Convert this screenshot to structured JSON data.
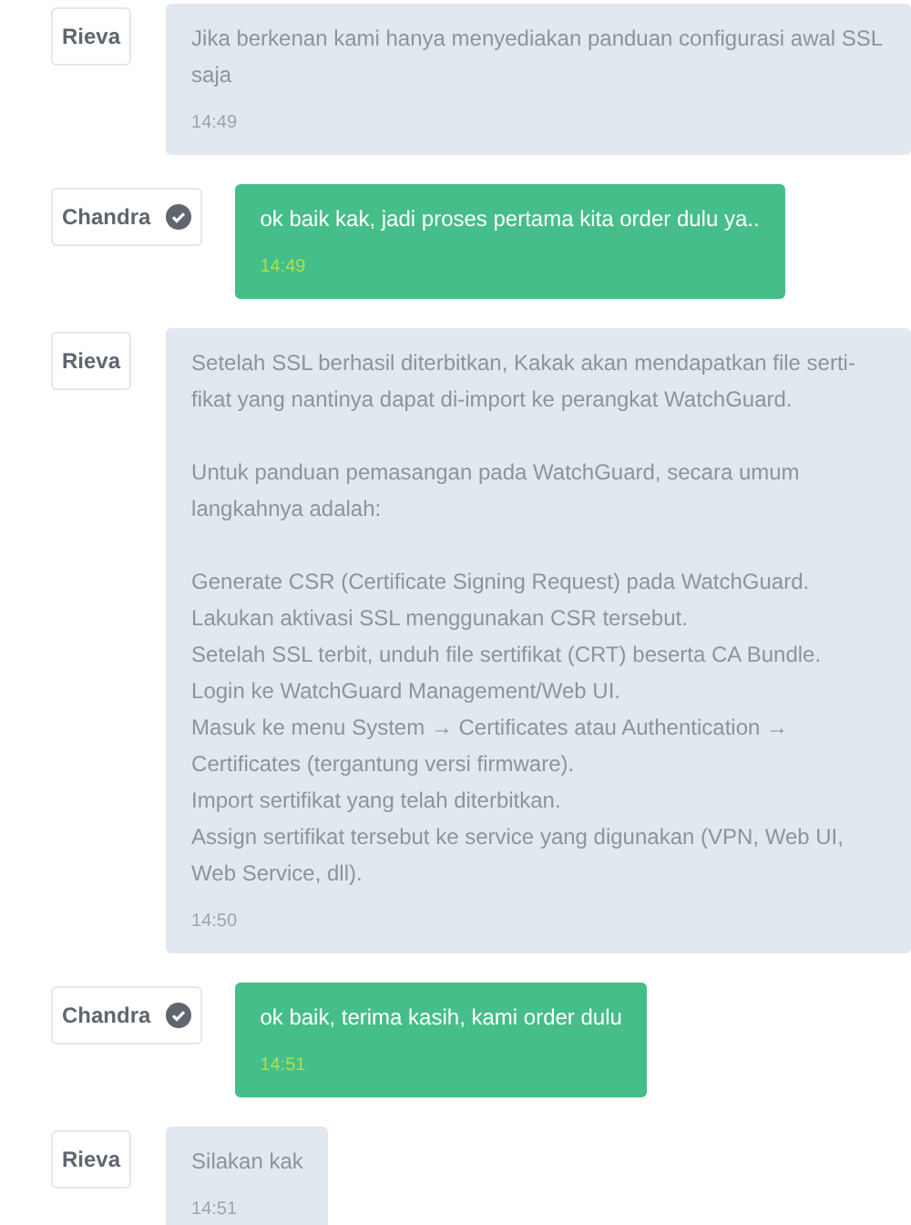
{
  "messages": [
    {
      "sender": "Rieva",
      "verified": false,
      "kind": "agent",
      "blocks": [
        [
          "Jika berkenan kami hanya menyediakan panduan configurasi awal SSL saja"
        ]
      ],
      "time": "14:49"
    },
    {
      "sender": "Chandra",
      "verified": true,
      "kind": "customer",
      "blocks": [
        [
          "ok baik kak, jadi proses pertama kita order dulu ya.."
        ]
      ],
      "time": "14:49"
    },
    {
      "sender": "Rieva",
      "verified": false,
      "kind": "agent",
      "blocks": [
        [
          "Setelah SSL berhasil diterbitkan, Kakak akan mendapatkan file serti-",
          "fikat yang nantinya dapat di-import ke perangkat WatchGuard."
        ],
        [
          "Untuk panduan pemasangan pada WatchGuard, secara umum langkahnya adalah:"
        ],
        [
          "Generate CSR (Certificate Signing Request) pada WatchGuard.",
          "Lakukan aktivasi SSL menggunakan CSR tersebut.",
          "Setelah SSL terbit, unduh file sertifikat (CRT) beserta CA Bundle.",
          "Login ke WatchGuard Management/Web UI.",
          "Masuk ke menu System → Certificates atau Authentication → Certificates (tergantung versi firmware).",
          "Import sertifikat yang telah diterbitkan.",
          "Assign sertifikat tersebut ke service yang digunakan (VPN, Web UI, Web Service, dll)."
        ]
      ],
      "time": "14:50"
    },
    {
      "sender": "Chandra",
      "verified": true,
      "kind": "customer",
      "blocks": [
        [
          "ok baik, terima kasih, kami order dulu"
        ]
      ],
      "time": "14:51"
    },
    {
      "sender": "Rieva",
      "verified": false,
      "kind": "agent",
      "blocks": [
        [
          "Silakan kak"
        ]
      ],
      "time": "14:51"
    }
  ]
}
